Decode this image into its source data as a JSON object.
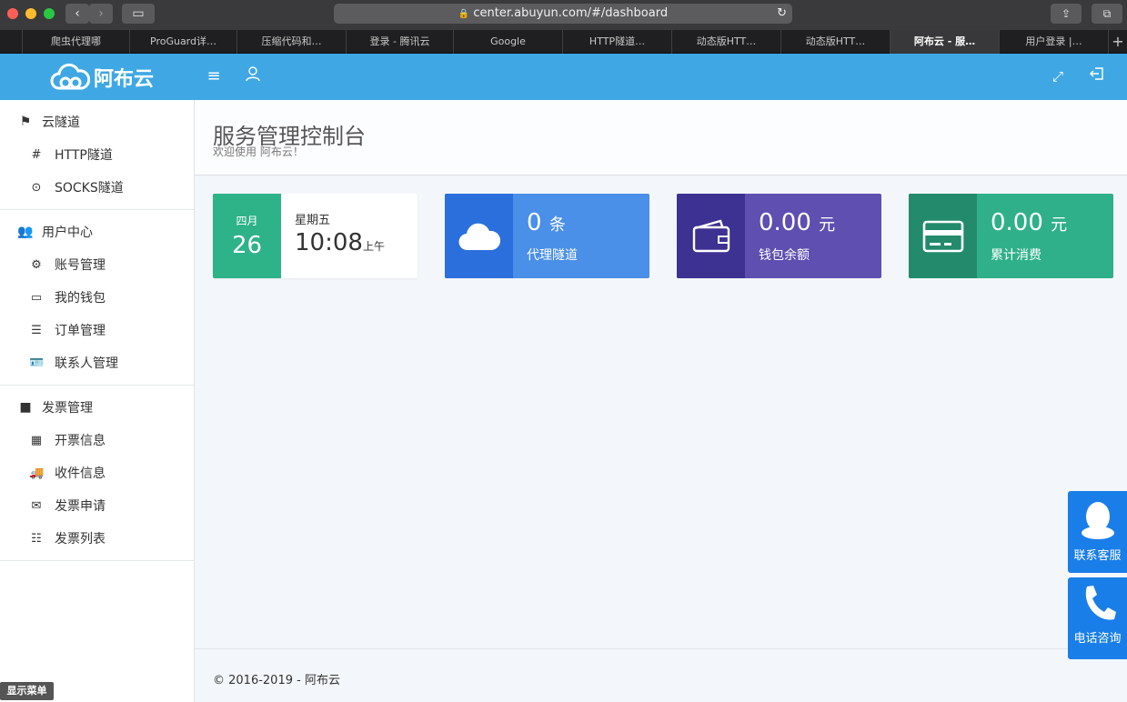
{
  "browser": {
    "url": "center.abuyun.com/#/dashboard",
    "tabs": [
      {
        "label": "爬虫代理哪"
      },
      {
        "label": "ProGuard详…"
      },
      {
        "label": "压缩代码和…"
      },
      {
        "label": "登录 - 腾讯云"
      },
      {
        "label": "Google"
      },
      {
        "label": "HTTP隧道…"
      },
      {
        "label": "动态版HTT…"
      },
      {
        "label": "动态版HTT…"
      },
      {
        "label": "阿布云 - 服…"
      },
      {
        "label": "用户登录 |…"
      }
    ],
    "new_tab": "+"
  },
  "header": {
    "logo_text": "阿布云",
    "menu_icon": "menu-icon",
    "user_icon": "user-icon",
    "fullscreen_icon": "expand-icon",
    "logout_icon": "logout-icon",
    "color": "#3fa8e4"
  },
  "sidebar": {
    "groups": [
      {
        "title": "云隧道",
        "icon": "signpost-icon",
        "items": [
          {
            "label": "HTTP隧道",
            "icon": "hash-icon"
          },
          {
            "label": "SOCKS隧道",
            "icon": "target-icon"
          }
        ]
      },
      {
        "title": "用户中心",
        "icon": "users-icon",
        "items": [
          {
            "label": "账号管理",
            "icon": "gear-icon"
          },
          {
            "label": "我的钱包",
            "icon": "folder-icon"
          },
          {
            "label": "订单管理",
            "icon": "list-icon"
          },
          {
            "label": "联系人管理",
            "icon": "id-card-icon"
          }
        ]
      },
      {
        "title": "发票管理",
        "icon": "folder-icon",
        "items": [
          {
            "label": "开票信息",
            "icon": "table-icon"
          },
          {
            "label": "收件信息",
            "icon": "truck-icon"
          },
          {
            "label": "发票申请",
            "icon": "envelope-icon"
          },
          {
            "label": "发票列表",
            "icon": "list-icon"
          }
        ]
      }
    ]
  },
  "page": {
    "title": "服务管理控制台",
    "subtitle": "欢迎使用 阿布云！"
  },
  "cards": {
    "date": {
      "month": "四月",
      "day": "26",
      "weekday": "星期五",
      "time": "10:08",
      "ampm": "上午",
      "color": "#2eb287"
    },
    "tunnels": {
      "value": "0",
      "unit": "条",
      "label": "代理隧道",
      "icon": "cloud-icon",
      "color": "#4a8fe8",
      "dark": "#2b6fdc"
    },
    "wallet": {
      "value": "0.00",
      "unit": "元",
      "label": "钱包余额",
      "icon": "wallet-icon",
      "color": "#5e4fb0",
      "dark": "#3d3192"
    },
    "spent": {
      "value": "0.00",
      "unit": "元",
      "label": "累计消费",
      "icon": "credit-card-icon",
      "color": "#2fb08a",
      "dark": "#238a6b"
    }
  },
  "footer": {
    "text": "© 2016-2019 - 阿布云"
  },
  "floating": {
    "service": {
      "label": "联系客服",
      "icon": "qq-penguin-icon"
    },
    "phone": {
      "label": "电话咨询",
      "icon": "phone-icon"
    }
  },
  "show_menu": "显示菜单"
}
